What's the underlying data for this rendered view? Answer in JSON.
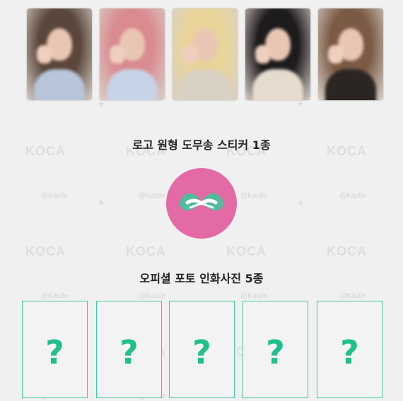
{
  "watermark": {
    "brand": "KOCA",
    "handle": "@Kastle"
  },
  "photocards": [
    {
      "name": "photocard-1",
      "hair": "#5a463a",
      "top": "#b8c6da"
    },
    {
      "name": "photocard-2",
      "hair": "#d98b8f",
      "top": "#c7d3e6"
    },
    {
      "name": "photocard-3",
      "hair": "#e9d49a",
      "top": "#d9d0c4"
    },
    {
      "name": "photocard-4",
      "hair": "#1e1b1d",
      "top": "#e6dccd"
    },
    {
      "name": "photocard-5",
      "hair": "#7a5a45",
      "top": "#2b2523"
    }
  ],
  "sections": {
    "sticker_title": "로고 원형 도무송 스티커 1종",
    "photos_title": "오피셜 포토 인화사진 5종"
  },
  "colors": {
    "sticker_bg": "#e36aa5",
    "accent": "#1fbf8e",
    "card_border": "#3fc8a4"
  },
  "mystery_cards": [
    "?",
    "?",
    "?",
    "?",
    "?"
  ]
}
